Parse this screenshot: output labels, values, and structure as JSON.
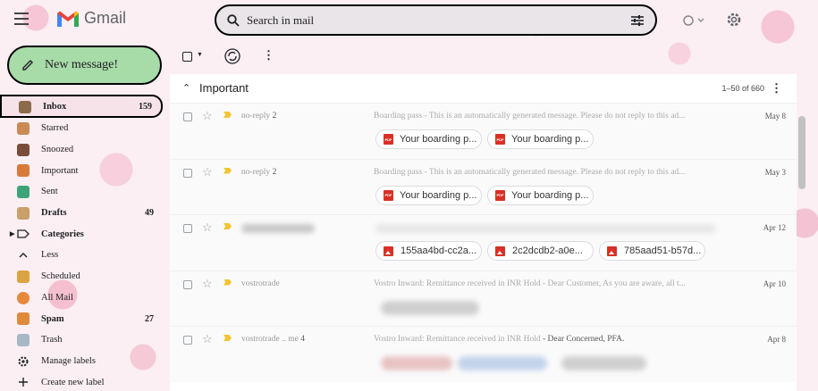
{
  "app": {
    "name": "Gmail"
  },
  "search": {
    "placeholder": "Search in mail"
  },
  "compose": {
    "label": "New message!"
  },
  "sidebar": {
    "items": [
      {
        "label": "Inbox",
        "count": "159"
      },
      {
        "label": "Starred",
        "count": ""
      },
      {
        "label": "Snoozed",
        "count": ""
      },
      {
        "label": "Important",
        "count": ""
      },
      {
        "label": "Sent",
        "count": ""
      },
      {
        "label": "Drafts",
        "count": "49"
      },
      {
        "label": "Categories",
        "count": ""
      },
      {
        "label": "Less",
        "count": ""
      },
      {
        "label": "Scheduled",
        "count": ""
      },
      {
        "label": "All Mail",
        "count": ""
      },
      {
        "label": "Spam",
        "count": "27"
      },
      {
        "label": "Trash",
        "count": ""
      },
      {
        "label": "Manage labels",
        "count": ""
      },
      {
        "label": "Create new label",
        "count": ""
      }
    ]
  },
  "section": {
    "title": "Important",
    "range": "1–50 of 660"
  },
  "emails": [
    {
      "sender": "no-reply",
      "count": "2",
      "subject": "Boarding pass",
      "snippet": " - This is an automatically generated message. Please do not reply to this ad...",
      "date": "May 8",
      "attachments": [
        "Your boarding p...",
        "Your boarding p..."
      ]
    },
    {
      "sender": "no-reply",
      "count": "2",
      "subject": "Boarding pass",
      "snippet": " - This is an automatically generated message. Please do not reply to this ad...",
      "date": "May 3",
      "attachments": [
        "Your boarding p...",
        "Your boarding p..."
      ]
    },
    {
      "sender": "",
      "count": "",
      "subject": "",
      "snippet": "",
      "date": "Apr 12",
      "attachments": [
        "155aa4bd-cc2a...",
        "2c2dcdb2-a0e...",
        "785aad51-b57d..."
      ]
    },
    {
      "sender": "vostrotrade",
      "count": "",
      "subject": "Vostro Inward: Remittance received in INR Hold",
      "snippet": " - Dear Customer, As you are aware, all t...",
      "date": "Apr 10",
      "attachments": []
    },
    {
      "sender": "vostrotrade .. me",
      "count": "4",
      "subject": "Vostro Inward: Remittance received in INR Hold",
      "snippet": " - Dear Concerned, PFA.",
      "date": "Apr 8",
      "attachments": []
    }
  ],
  "colors": {
    "compose_bg": "#a7dba8",
    "important_marker": "#f4c430",
    "attachment_icon": "#d93025"
  }
}
